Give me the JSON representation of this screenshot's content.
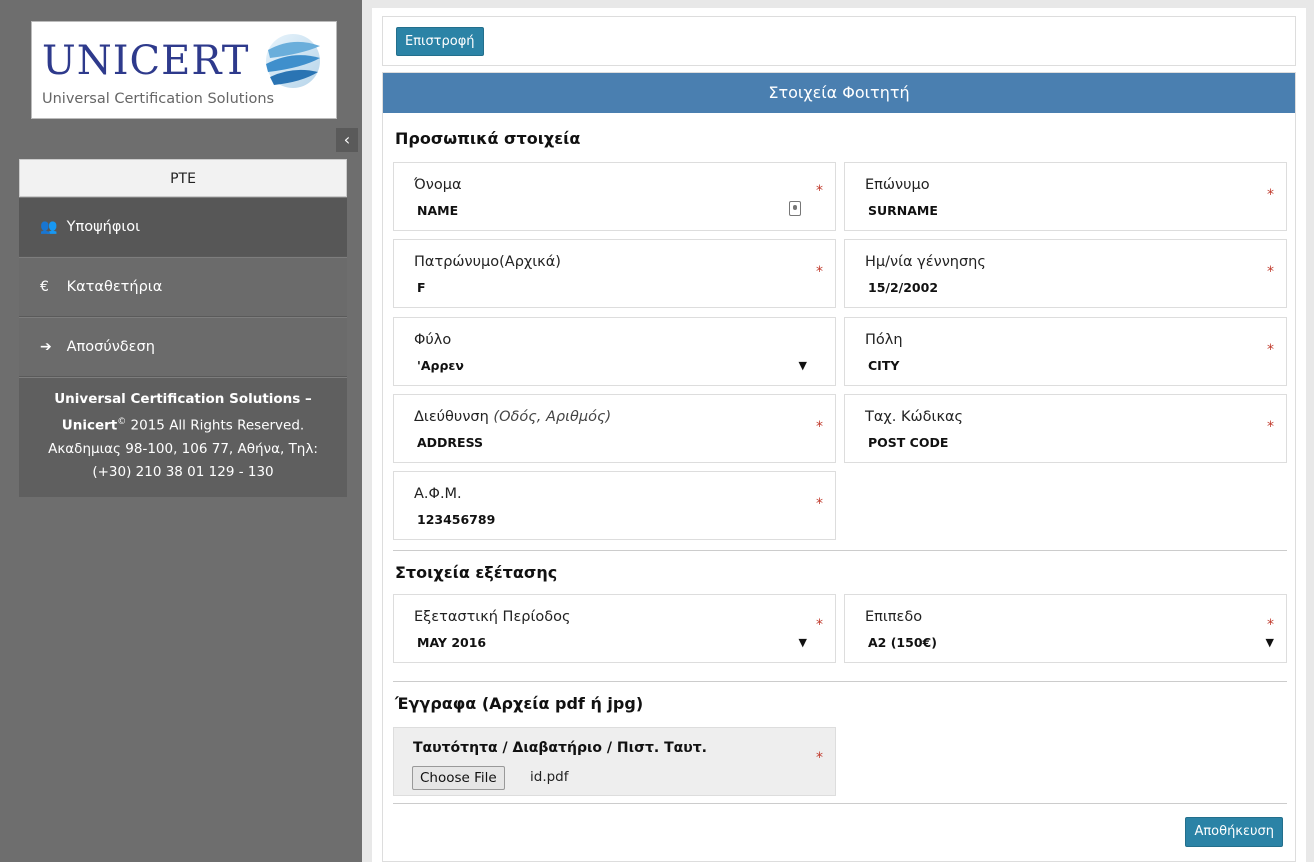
{
  "sidebar": {
    "logo": {
      "wordmark": "UNICERT",
      "subtitle": "Universal Certification Solutions"
    },
    "collapse_glyph": "‹",
    "menu_title": "PTE",
    "items": [
      {
        "label": "Υποψήφιοι",
        "icon": "users-icon",
        "glyph": "👥"
      },
      {
        "label": "Καταθετήρια",
        "icon": "euro-icon",
        "glyph": "€"
      },
      {
        "label": "Αποσύνδεση",
        "icon": "logout-icon",
        "glyph": "➔"
      }
    ],
    "footer": {
      "line1": "Universal Certification Solutions –",
      "brand": "Unicert",
      "copyright_mark": "©",
      "line2_rest": " 2015 All Rights Reserved.",
      "line3": "Ακαδημιας 98-100, 106 77, Αθήνα, Τηλ:",
      "line4": "(+30) 210 38 01 129 - 130"
    }
  },
  "toolbar": {
    "back_label": "Επιστροφή"
  },
  "panel": {
    "title": "Στοιχεία Φοιτητή",
    "personal_section": "Προσωπικά στοιχεία",
    "exam_section": "Στοιχεία εξέτασης",
    "docs_section": "Έγγραφα (Αρχεία pdf ή jpg)",
    "required_mark": "*",
    "fields": {
      "first_name": {
        "label": "Όνομα",
        "value": "NAME"
      },
      "surname": {
        "label": "Επώνυμο",
        "value": "SURNAME"
      },
      "fathers_initials": {
        "label": "Πατρώνυμο(Αρχικά)",
        "value": "F"
      },
      "birth_date": {
        "label": "Ημ/νία γέννησης",
        "value": "15/2/2002"
      },
      "gender": {
        "label": "Φύλο",
        "value": "'Αρρεν"
      },
      "city": {
        "label": "Πόλη",
        "value": "CITY"
      },
      "address": {
        "label": "Διεύθυνση",
        "hint": "(Οδός, Αριθμός)",
        "value": "ADDRESS"
      },
      "post_code": {
        "label": "Ταχ. Κώδικας",
        "value": "POST CODE"
      },
      "tax_id": {
        "label": "Α.Φ.Μ.",
        "value": "123456789"
      },
      "exam_period": {
        "label": "Εξεταστική Περίοδος",
        "value": "MAY 2016"
      },
      "level": {
        "label": "Επιπεδο",
        "value": "A2 (150€)"
      }
    },
    "document": {
      "label": "Ταυτότητα / Διαβατήριο / Πιστ. Ταυτ.",
      "button": "Choose File",
      "file_name": "id.pdf"
    },
    "save_label": "Αποθήκευση",
    "dropdown_caret": "▼"
  },
  "colors": {
    "header_blue": "#4a7fb0",
    "button_teal": "#2b83a6",
    "sidebar_grey": "#6e6e6e",
    "required_red": "#c0392b",
    "logo_navy": "#2e3a8c"
  }
}
